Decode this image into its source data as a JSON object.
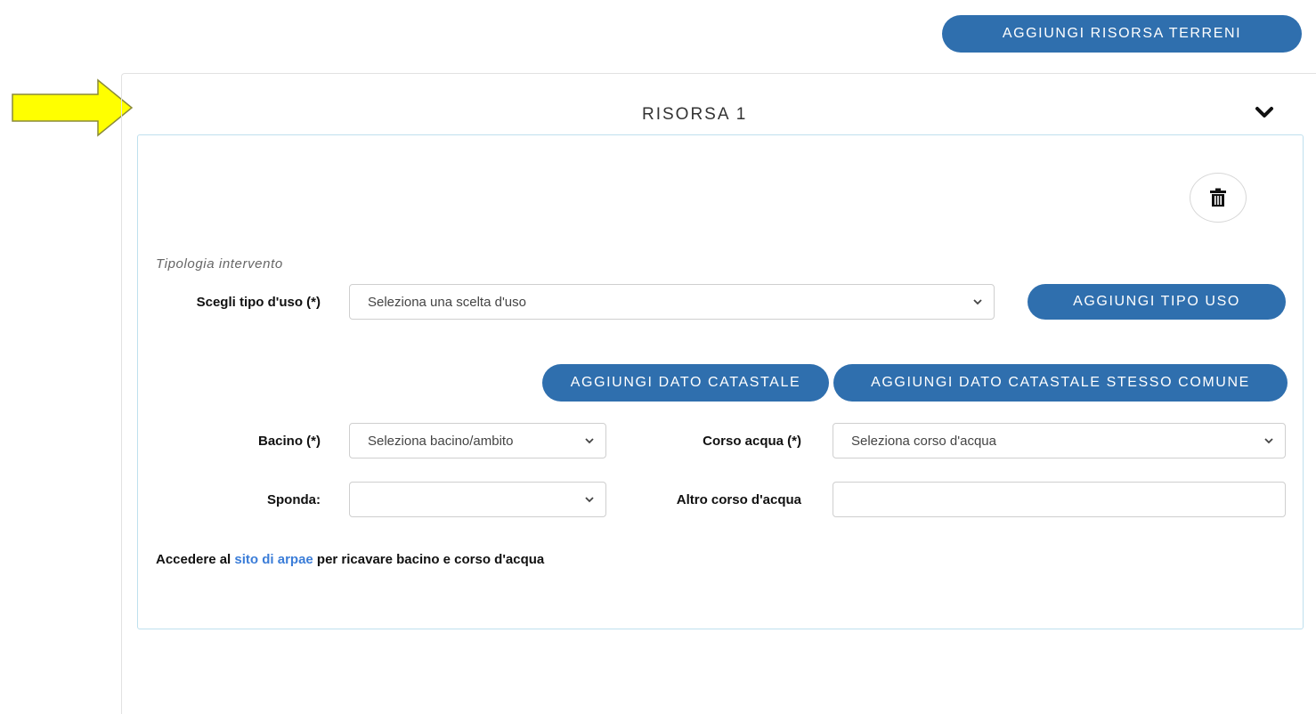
{
  "header": {
    "add_resource_label": "AGGIUNGI RISORSA TERRENI"
  },
  "resource": {
    "title": "RISORSA 1",
    "section_label": "Tipologia intervento",
    "uso": {
      "label": "Scegli tipo d'uso (*)",
      "placeholder": "Seleziona una scelta d'uso",
      "add_button": "AGGIUNGI TIPO USO"
    },
    "catasto": {
      "add_button": "AGGIUNGI DATO CATASTALE",
      "add_same_comune_button": "AGGIUNGI DATO CATASTALE STESSO COMUNE"
    },
    "bacino": {
      "label": "Bacino (*)",
      "placeholder": "Seleziona bacino/ambito"
    },
    "corso_acqua": {
      "label": "Corso acqua (*)",
      "placeholder": "Seleziona corso d'acqua"
    },
    "sponda": {
      "label": "Sponda:",
      "value": ""
    },
    "altro_corso": {
      "label": "Altro corso d'acqua",
      "value": ""
    },
    "note": {
      "prefix": "Accedere al ",
      "link_text": "sito di arpae",
      "suffix": " per ricavare bacino e corso d'acqua"
    }
  },
  "icons": {
    "arrow": "arrow-right-icon",
    "collapse": "chevron-down-icon",
    "delete": "trash-icon",
    "caret": "caret-down-icon"
  },
  "colors": {
    "primary": "#2f6fae",
    "link": "#3b7dd8",
    "annotation_arrow": "#ffff00",
    "panel_border": "#bfe0ee"
  }
}
